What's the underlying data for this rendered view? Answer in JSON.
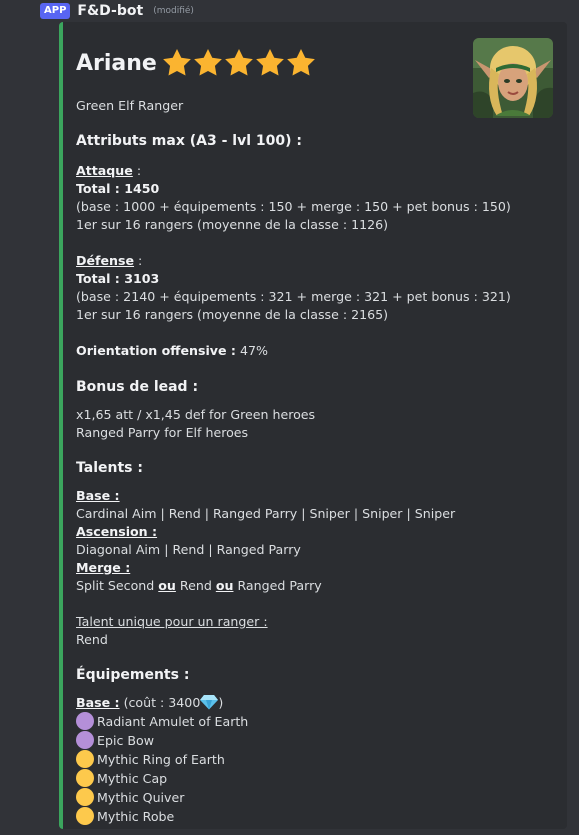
{
  "header": {
    "app_badge": "APP",
    "bot_name": "F&D-bot",
    "edited": "(modifié)"
  },
  "hero": {
    "name": "Ariane",
    "star_count": 5,
    "subtitle": "Green Elf Ranger"
  },
  "attributes": {
    "title": "Attributs max (A3 - lvl 100) :",
    "attack": {
      "label": "Attaque",
      "colon": " :",
      "total": "Total : 1450",
      "detail": "(base : 1000 + équipements : 150 + merge : 150 + pet bonus : 150)",
      "rank": "1er sur 16 rangers (moyenne de la classe : 1126)"
    },
    "defense": {
      "label": "Défense",
      "colon": " :",
      "total": "Total : 3103",
      "detail": "(base : 2140 + équipements : 321 + merge : 321 + pet bonus : 321)",
      "rank": "1er sur 16 rangers (moyenne de la classe : 2165)"
    },
    "orientation_label": "Orientation offensive :",
    "orientation_value": " 47%"
  },
  "lead": {
    "title": "Bonus de lead :",
    "line1": "x1,65 att / x1,45 def for Green heroes",
    "line2": "Ranged Parry for Elf heroes"
  },
  "talents": {
    "title": "Talents :",
    "base_label": "Base :",
    "base_value": "Cardinal Aim | Rend | Ranged Parry | Sniper | Sniper | Sniper",
    "ascension_label": "Ascension :",
    "ascension_value": "Diagonal Aim | Rend | Ranged Parry",
    "merge_label": "Merge :",
    "merge_a": "Split Second ",
    "merge_or1": "ou",
    "merge_b": " Rend ",
    "merge_or2": "ou",
    "merge_c": " Ranged Parry",
    "unique_label": "Talent unique pour un ranger :",
    "unique_value": "Rend"
  },
  "equipment": {
    "title": "Équipements :",
    "base_label": "Base :",
    "cost": " (coût : 3400",
    "cost_close": ")",
    "items": [
      {
        "name": "Radiant Amulet of Earth",
        "rarity_color": "#b48fd8"
      },
      {
        "name": "Epic Bow",
        "rarity_color": "#b48fd8"
      },
      {
        "name": "Mythic Ring of Earth",
        "rarity_color": "#fdc94c"
      },
      {
        "name": "Mythic Cap",
        "rarity_color": "#fdc94c"
      },
      {
        "name": "Mythic Quiver",
        "rarity_color": "#fdc94c"
      },
      {
        "name": "Mythic Robe",
        "rarity_color": "#fdc94c"
      }
    ]
  },
  "colors": {
    "embed_border": "#3ba55d",
    "star": "#fbb430",
    "app_badge": "#5865f2"
  }
}
